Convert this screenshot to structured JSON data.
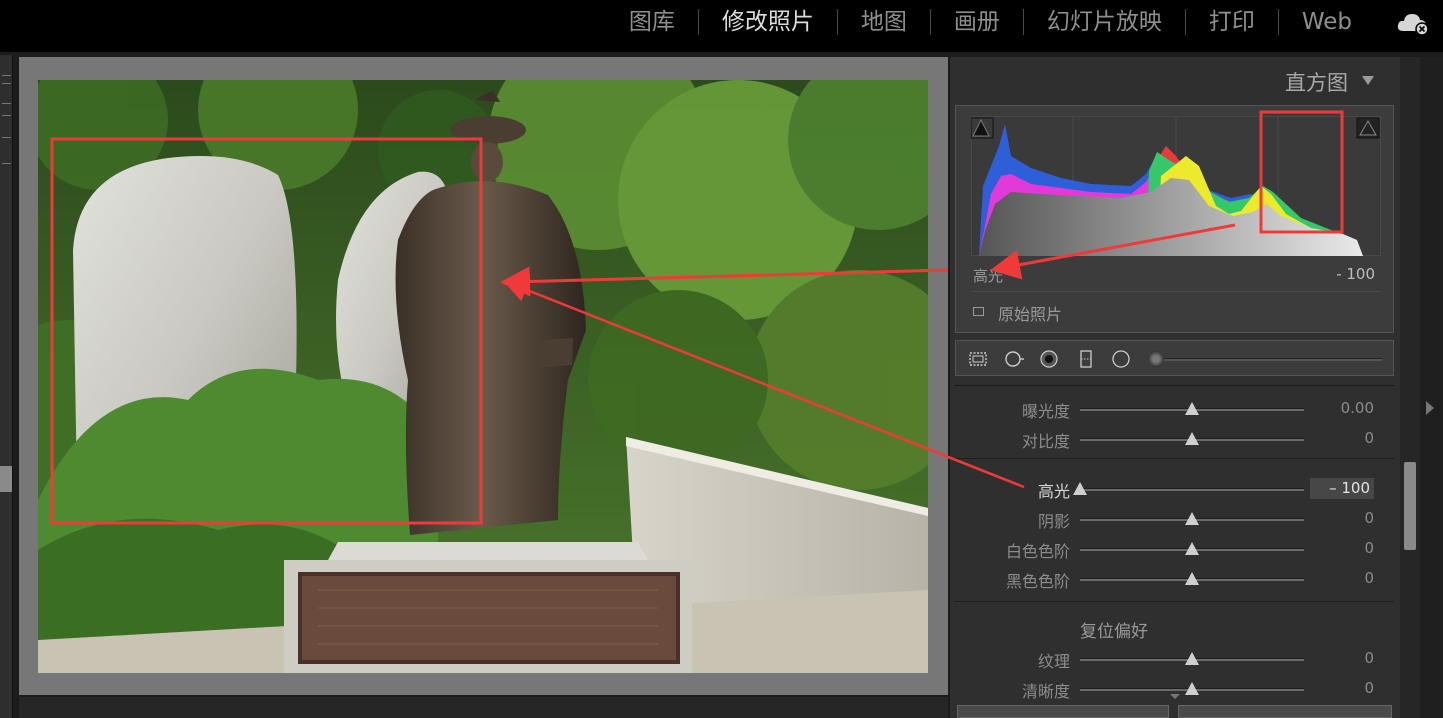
{
  "modules": [
    "图库",
    "修改照片",
    "地图",
    "画册",
    "幻灯片放映",
    "打印",
    "Web"
  ],
  "active_module": "修改照片",
  "histogram": {
    "title": "直方图",
    "label": "高光",
    "value": "- 100",
    "original_photo_label": "原始照片"
  },
  "basic_sliders": [
    {
      "label": "曝光度",
      "value": "0.00",
      "position": 0.5
    },
    {
      "label": "对比度",
      "value": "0",
      "position": 0.5
    },
    {
      "label": "高光",
      "value": "– 100",
      "position": 0.0,
      "highlighted": true
    },
    {
      "label": "阴影",
      "value": "0",
      "position": 0.5
    },
    {
      "label": "白色色阶",
      "value": "0",
      "position": 0.5
    },
    {
      "label": "黑色色阶",
      "value": "0",
      "position": 0.5
    }
  ],
  "presence": {
    "title": "复位偏好",
    "sliders": [
      {
        "label": "纹理",
        "value": "0",
        "position": 0.5
      },
      {
        "label": "清晰度",
        "value": "0",
        "position": 0.5
      }
    ]
  },
  "colors": {
    "annotation_red": "#f03a3a",
    "hist_blue": "#2f5fd8",
    "hist_magenta": "#e23ad8",
    "hist_yellow": "#ecea2a",
    "hist_red": "#e83a3a",
    "hist_green": "#34c86a"
  },
  "icons": [
    "cloud-sync-error-icon",
    "crop-overlay-icon",
    "spot-removal-icon",
    "red-eye-icon",
    "graduated-filter-icon",
    "radial-filter-icon",
    "adjustment-brush-icon"
  ]
}
